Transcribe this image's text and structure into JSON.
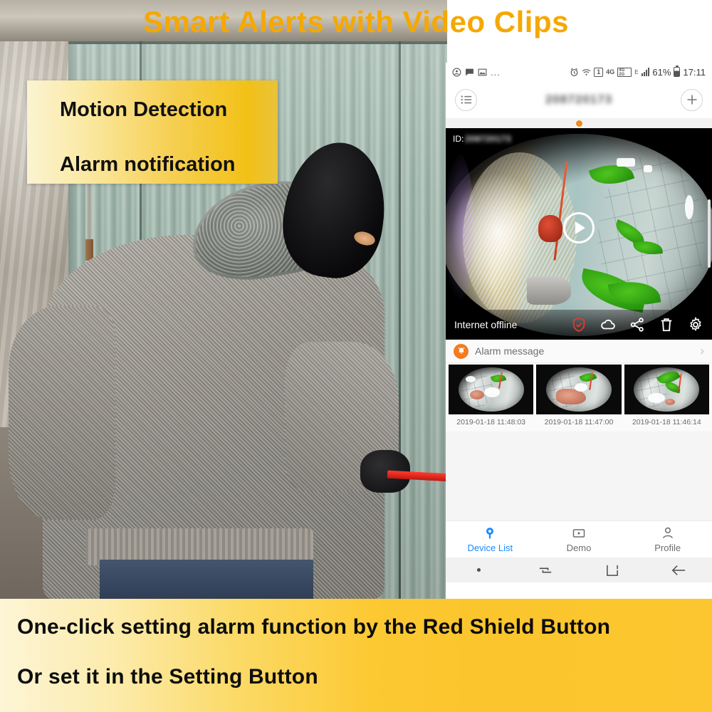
{
  "hero": {
    "title": "Smart Alerts with Video Clips",
    "title_color": "#f5a800"
  },
  "callout": {
    "line1": "Motion Detection",
    "line2": "Alarm notification"
  },
  "caption": {
    "line1": "One-click setting alarm function by the Red Shield Button",
    "line2": "Or set it in the Setting Button",
    "band_color": "#fbc62f"
  },
  "phone": {
    "statusbar": {
      "left_icons": [
        "account-icon",
        "message-icon",
        "photo-icon"
      ],
      "overflow": "...",
      "alarm_icon": "alarm-clock-icon",
      "wifi_icon": "wifi-icon",
      "sim_label": "1",
      "net_4g": "4G",
      "net_box_top": "4G",
      "net_box_bottom": "2G",
      "net_e": "E",
      "battery_percent": "61%",
      "clock": "17:11"
    },
    "header": {
      "menu_icon": "list-menu-icon",
      "title": "208720173",
      "add_icon": "plus-icon",
      "page_dot_color": "#f08a1d"
    },
    "video": {
      "id_label": "ID:",
      "id_value": "208720173",
      "play_icon": "play-icon",
      "status_text": "Internet offline",
      "icons": [
        {
          "name": "shield-check-icon",
          "color": "#e03b30"
        },
        {
          "name": "cloud-icon",
          "color": "#ffffff"
        },
        {
          "name": "share-icon",
          "color": "#ffffff"
        },
        {
          "name": "trash-icon",
          "color": "#ffffff"
        },
        {
          "name": "gear-icon",
          "color": "#ffffff"
        }
      ]
    },
    "alarm_section": {
      "badge_icon": "alarm-bell-icon",
      "title": "Alarm message",
      "chevron": "›",
      "clips": [
        {
          "time": "2019-01-18 11:48:03"
        },
        {
          "time": "2019-01-18 11:47:00"
        },
        {
          "time": "2019-01-18 11:46:14"
        }
      ]
    },
    "tabs": [
      {
        "label": "Device List",
        "icon": "camera-device-icon",
        "active": true
      },
      {
        "label": "Demo",
        "icon": "video-play-box-icon",
        "active": false
      },
      {
        "label": "Profile",
        "icon": "person-icon",
        "active": false
      }
    ],
    "navbar": [
      {
        "name": "nav-dot"
      },
      {
        "name": "nav-recents-icon"
      },
      {
        "name": "nav-home-icon"
      },
      {
        "name": "nav-back-icon"
      }
    ],
    "accent_color": "#1a8cff"
  }
}
